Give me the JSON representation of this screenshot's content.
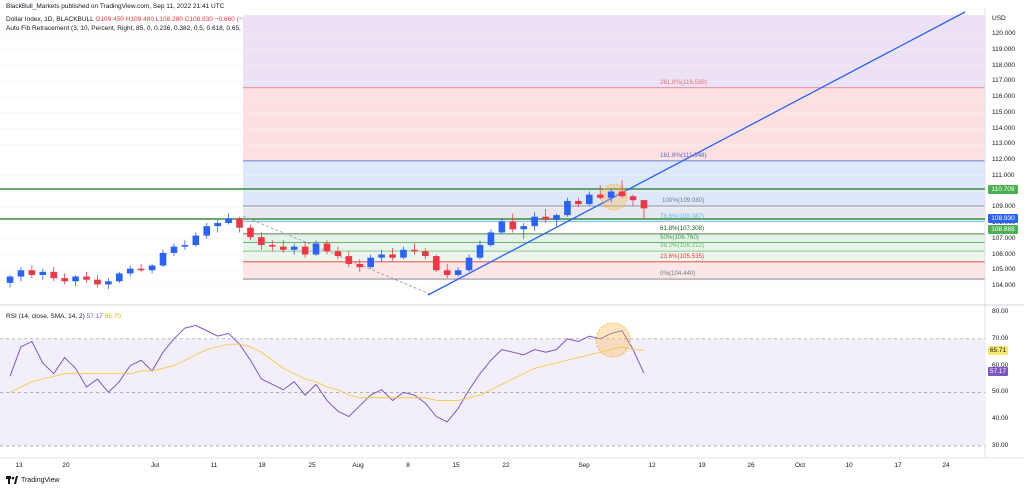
{
  "header": {
    "publisher": "BlackBull_Markets published on TradingView.com, Sep 11, 2022 21:41 UTC",
    "symbol_line": {
      "name": "Dollar Index, 1D, BLACKBULL",
      "o": "O109.450",
      "h": "H109.480",
      "l": "L108.280",
      "c": "C108.930",
      "chg": "−0.660 (−0.60%)"
    },
    "indicator": "Auto Fib Retracement (3, 10, Percent, Right, 85, 0, 0.236, 0.382, 0.5, 0.618, 0.65, 0.786, 1, 1.272, 1.414, 1.618, 1.65, 2.618, 2.65, 3.618, 3.65, 4.236, 4.618, -0.236, -0.382, -0.618, -0.65)"
  },
  "price_axis": {
    "currency": "USD",
    "ticks": [
      "120.000",
      "119.000",
      "118.000",
      "117.000",
      "116.000",
      "115.000",
      "114.000",
      "113.000",
      "112.000",
      "111.000",
      "110.000",
      "109.000",
      "108.000",
      "107.000",
      "106.000",
      "105.000",
      "104.000"
    ],
    "tag_high": {
      "label": "110.709",
      "color": "#4caf50"
    },
    "tag_last": {
      "label": "108.930",
      "color": "#2962ff"
    },
    "tag_low": {
      "label": "108.888",
      "color": "#4caf50"
    }
  },
  "rsi_axis": {
    "ticks": [
      "80.00",
      "70.00",
      "60.00",
      "50.00",
      "40.00",
      "30.00"
    ],
    "tag_ma": {
      "label": "65.71",
      "color": "#f7e96e"
    },
    "tag_rsi": {
      "label": "57.17",
      "color": "#7e57c2"
    }
  },
  "rsi_header": {
    "label": "RSI (14, close, SMA, 14, 2)",
    "rsi_value": "57.17",
    "ma_value": "65.70",
    "rsi_color": "#7e57c2",
    "ma_color": "#f7e96e"
  },
  "fib_levels": [
    {
      "label": "261.8%(116.588)",
      "value": 116.588,
      "color": "#e57373"
    },
    {
      "label": "161.8%(111.948)",
      "value": 111.948,
      "color": "#5c6bc0"
    },
    {
      "label": "100%(109.080)",
      "value": 109.08,
      "color": "#787b86"
    },
    {
      "label": "78.6%(108.087)",
      "value": 108.087,
      "color": "#64b5f6"
    },
    {
      "label": "61.8%(107.308)",
      "value": 107.308,
      "color": "#1b5e20"
    },
    {
      "label": "50%(106.760)",
      "value": 106.76,
      "color": "#43a047"
    },
    {
      "label": "38.2%(106.212)",
      "value": 106.212,
      "color": "#66bb6a"
    },
    {
      "label": "23.6%(105.535)",
      "value": 105.535,
      "color": "#e53935"
    },
    {
      "label": "0%(104.440)",
      "value": 104.44,
      "color": "#787b86"
    }
  ],
  "x_axis": {
    "ticks": [
      "13",
      "20",
      "Jul",
      "11",
      "18",
      "25",
      "Aug",
      "8",
      "15",
      "22",
      "Sep",
      "12",
      "19",
      "26",
      "Oct",
      "10",
      "17",
      "24"
    ]
  },
  "footer": {
    "brand": "TradingView"
  },
  "chart_data": {
    "type": "candlestick",
    "y_unit": "USD",
    "ylim": [
      103.6,
      120.9
    ],
    "candles_ohlc": [
      [
        104.2,
        104.7,
        103.9,
        104.6
      ],
      [
        104.6,
        105.2,
        104.3,
        105.0
      ],
      [
        105.0,
        105.3,
        104.5,
        104.7
      ],
      [
        104.7,
        105.1,
        104.4,
        104.9
      ],
      [
        104.9,
        105.2,
        104.3,
        104.5
      ],
      [
        104.5,
        104.8,
        104.1,
        104.3
      ],
      [
        104.3,
        104.7,
        104.0,
        104.6
      ],
      [
        104.6,
        104.9,
        104.2,
        104.4
      ],
      [
        104.4,
        104.7,
        103.9,
        104.1
      ],
      [
        104.1,
        104.5,
        103.8,
        104.3
      ],
      [
        104.3,
        104.9,
        104.2,
        104.8
      ],
      [
        104.8,
        105.3,
        104.6,
        105.1
      ],
      [
        105.1,
        105.4,
        104.9,
        105.0
      ],
      [
        105.0,
        105.4,
        104.8,
        105.3
      ],
      [
        105.3,
        106.3,
        105.2,
        106.1
      ],
      [
        106.1,
        106.7,
        105.9,
        106.5
      ],
      [
        106.5,
        106.9,
        106.3,
        106.6
      ],
      [
        106.6,
        107.4,
        106.5,
        107.2
      ],
      [
        107.2,
        108.0,
        107.0,
        107.8
      ],
      [
        107.8,
        108.2,
        107.4,
        108.0
      ],
      [
        108.0,
        108.6,
        107.9,
        108.3
      ],
      [
        108.3,
        108.4,
        107.4,
        107.7
      ],
      [
        107.7,
        107.9,
        106.9,
        107.1
      ],
      [
        107.1,
        107.4,
        106.3,
        106.6
      ],
      [
        106.6,
        106.9,
        106.2,
        106.5
      ],
      [
        106.5,
        106.9,
        106.1,
        106.3
      ],
      [
        106.3,
        106.7,
        106.0,
        106.5
      ],
      [
        106.5,
        106.8,
        105.8,
        106.0
      ],
      [
        106.0,
        106.9,
        105.9,
        106.7
      ],
      [
        106.7,
        106.9,
        106.0,
        106.2
      ],
      [
        106.2,
        106.5,
        105.7,
        105.9
      ],
      [
        105.9,
        106.2,
        105.2,
        105.4
      ],
      [
        105.4,
        105.7,
        104.9,
        105.2
      ],
      [
        105.2,
        106.0,
        105.1,
        105.8
      ],
      [
        105.8,
        106.3,
        105.5,
        106.0
      ],
      [
        106.0,
        106.4,
        105.6,
        105.8
      ],
      [
        105.8,
        106.5,
        105.7,
        106.3
      ],
      [
        106.3,
        106.7,
        106.0,
        106.2
      ],
      [
        106.2,
        106.4,
        105.7,
        105.9
      ],
      [
        105.9,
        106.0,
        104.9,
        105.0
      ],
      [
        105.0,
        105.4,
        104.5,
        104.7
      ],
      [
        104.7,
        105.2,
        104.6,
        105.0
      ],
      [
        105.0,
        106.0,
        104.9,
        105.8
      ],
      [
        105.8,
        106.9,
        105.7,
        106.6
      ],
      [
        106.6,
        107.6,
        106.5,
        107.4
      ],
      [
        107.4,
        108.3,
        107.3,
        108.1
      ],
      [
        108.1,
        108.6,
        107.4,
        107.6
      ],
      [
        107.6,
        108.0,
        107.0,
        107.8
      ],
      [
        107.8,
        108.7,
        107.5,
        108.4
      ],
      [
        108.4,
        108.9,
        108.0,
        108.2
      ],
      [
        108.2,
        108.6,
        107.8,
        108.5
      ],
      [
        108.5,
        109.6,
        108.4,
        109.4
      ],
      [
        109.4,
        109.6,
        109.0,
        109.2
      ],
      [
        109.2,
        110.0,
        109.1,
        109.8
      ],
      [
        109.8,
        110.4,
        109.5,
        109.6
      ],
      [
        109.6,
        110.2,
        109.3,
        110.0
      ],
      [
        110.0,
        110.7,
        109.6,
        109.7
      ],
      [
        109.7,
        109.8,
        109.1,
        109.45
      ],
      [
        109.45,
        109.48,
        108.28,
        108.93
      ]
    ],
    "rsi": [
      56,
      67,
      69,
      61,
      57,
      63,
      59,
      52,
      55,
      50,
      54,
      60,
      62,
      58,
      65,
      70,
      74,
      75,
      73,
      71,
      72,
      68,
      62,
      55,
      53,
      51,
      54,
      49,
      53,
      47,
      43,
      41,
      45,
      49,
      51,
      47,
      50,
      49,
      46,
      41,
      39,
      44,
      51,
      57,
      62,
      66,
      65,
      64,
      66,
      65,
      66,
      70,
      69,
      71,
      70,
      72,
      73,
      66,
      57.17
    ],
    "rsi_ma": [
      50,
      52,
      54,
      55,
      56,
      57,
      57,
      57,
      57,
      57,
      57,
      57,
      58,
      58,
      59,
      60,
      62,
      64,
      66,
      67,
      68,
      68,
      67,
      65,
      62,
      59,
      57,
      55,
      54,
      52,
      51,
      49,
      48,
      48,
      48,
      48,
      48,
      48,
      48,
      47,
      47,
      47,
      48,
      49,
      51,
      53,
      55,
      57,
      59,
      60,
      61,
      62,
      63,
      64,
      65,
      66,
      67,
      66,
      65.71
    ]
  }
}
